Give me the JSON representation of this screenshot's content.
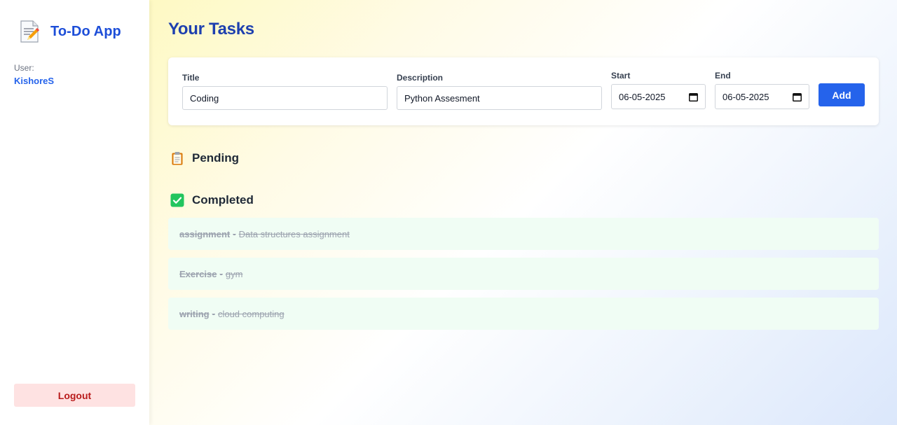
{
  "sidebar": {
    "app_title": "To-Do App",
    "user_label": "User:",
    "user_name": "KishoreS",
    "logout_label": "Logout"
  },
  "main": {
    "page_title": "Your Tasks",
    "form": {
      "title_label": "Title",
      "title_value": "Coding",
      "description_label": "Description",
      "description_value": "Python Assesment",
      "start_label": "Start",
      "start_value": "06-05-2025",
      "end_label": "End",
      "end_value": "06-05-2025",
      "add_label": "Add"
    },
    "pending": {
      "heading": "Pending",
      "icon": "clipboard-icon",
      "tasks": []
    },
    "completed": {
      "heading": "Completed",
      "icon": "checkbox-checked-icon",
      "tasks": [
        {
          "title": "assignment",
          "separator": "-",
          "description": "Data structures assignment"
        },
        {
          "title": "Exercise",
          "separator": "-",
          "description": "gym"
        },
        {
          "title": "writing",
          "separator": "-",
          "description": "cloud computing"
        }
      ]
    }
  },
  "colors": {
    "brand_blue": "#1d4ed8",
    "add_button": "#2563eb",
    "logout_bg": "#fee2e2",
    "logout_text": "#b91c1c",
    "completed_bg": "#f0fdf4",
    "check_green": "#22c55e"
  }
}
